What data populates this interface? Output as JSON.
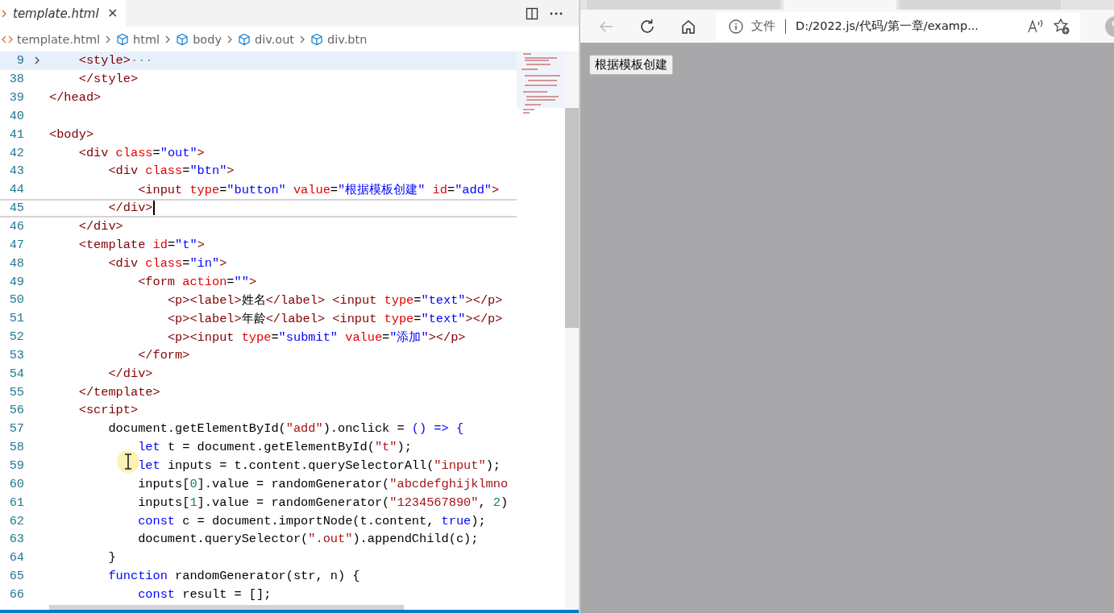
{
  "editor": {
    "tab": {
      "title": "template.html",
      "close": "✕"
    },
    "breadcrumbs": [
      {
        "kind": "file",
        "label": "template.html"
      },
      {
        "kind": "element",
        "label": "html"
      },
      {
        "kind": "element",
        "label": "body"
      },
      {
        "kind": "element",
        "label": "div.out"
      },
      {
        "kind": "element",
        "label": "div.btn"
      }
    ],
    "lines": [
      {
        "number": "9",
        "folded": true,
        "highlighted": true,
        "current": false,
        "tokens": [
          {
            "kind": "tag",
            "text": "    <style>"
          },
          {
            "kind": "fold",
            "text": "···"
          }
        ]
      },
      {
        "number": "38",
        "folded": false,
        "highlighted": false,
        "current": false,
        "tokens": [
          {
            "kind": "tag",
            "text": "    </style>"
          }
        ]
      },
      {
        "number": "39",
        "folded": false,
        "highlighted": false,
        "current": false,
        "tokens": [
          {
            "kind": "tag",
            "text": "</head>"
          }
        ]
      },
      {
        "number": "40",
        "folded": false,
        "highlighted": false,
        "current": false
      },
      {
        "number": "41",
        "folded": false,
        "highlighted": false,
        "current": false,
        "tokens": [
          {
            "kind": "tag",
            "text": "<body>"
          }
        ]
      },
      {
        "number": "42",
        "folded": false,
        "highlighted": false,
        "current": false,
        "tokens": [
          {
            "kind": "tag",
            "text": "    <div"
          },
          {
            "kind": "attr",
            "text": " class"
          },
          {
            "kind": "plain",
            "text": "="
          },
          {
            "kind": "val",
            "text": "\"out\""
          },
          {
            "kind": "tag",
            "text": ">"
          }
        ]
      },
      {
        "number": "43",
        "folded": false,
        "highlighted": false,
        "current": false,
        "tokens": [
          {
            "kind": "tag",
            "text": "        <div"
          },
          {
            "kind": "attr",
            "text": " class"
          },
          {
            "kind": "plain",
            "text": "="
          },
          {
            "kind": "val",
            "text": "\"btn\""
          },
          {
            "kind": "tag",
            "text": ">"
          }
        ]
      },
      {
        "number": "44",
        "folded": false,
        "highlighted": false,
        "current": false,
        "tokens": [
          {
            "kind": "tag",
            "text": "            <input"
          },
          {
            "kind": "attr",
            "text": " type"
          },
          {
            "kind": "plain",
            "text": "="
          },
          {
            "kind": "val",
            "text": "\"button\""
          },
          {
            "kind": "attr",
            "text": " value"
          },
          {
            "kind": "plain",
            "text": "="
          },
          {
            "kind": "val",
            "text": "\"根据模板创建\""
          },
          {
            "kind": "attr",
            "text": " id"
          },
          {
            "kind": "plain",
            "text": "="
          },
          {
            "kind": "val",
            "text": "\"add\""
          },
          {
            "kind": "tag",
            "text": ">"
          }
        ]
      },
      {
        "number": "45",
        "folded": false,
        "highlighted": false,
        "current": true,
        "tokens": [
          {
            "kind": "tag",
            "text": "        </div>"
          }
        ]
      },
      {
        "number": "46",
        "folded": false,
        "highlighted": false,
        "current": false,
        "tokens": [
          {
            "kind": "tag",
            "text": "    </div>"
          }
        ]
      },
      {
        "number": "47",
        "folded": false,
        "highlighted": false,
        "current": false,
        "tokens": [
          {
            "kind": "tag",
            "text": "    <template"
          },
          {
            "kind": "attr",
            "text": " id"
          },
          {
            "kind": "plain",
            "text": "="
          },
          {
            "kind": "val",
            "text": "\"t\""
          },
          {
            "kind": "tag",
            "text": ">"
          }
        ]
      },
      {
        "number": "48",
        "folded": false,
        "highlighted": false,
        "current": false,
        "tokens": [
          {
            "kind": "tag",
            "text": "        <div"
          },
          {
            "kind": "attr",
            "text": " class"
          },
          {
            "kind": "plain",
            "text": "="
          },
          {
            "kind": "val",
            "text": "\"in\""
          },
          {
            "kind": "tag",
            "text": ">"
          }
        ]
      },
      {
        "number": "49",
        "folded": false,
        "highlighted": false,
        "current": false,
        "tokens": [
          {
            "kind": "tag",
            "text": "            <form"
          },
          {
            "kind": "attr",
            "text": " action"
          },
          {
            "kind": "plain",
            "text": "="
          },
          {
            "kind": "val",
            "text": "\"\""
          },
          {
            "kind": "tag",
            "text": ">"
          }
        ]
      },
      {
        "number": "50",
        "folded": false,
        "highlighted": false,
        "current": false,
        "tokens": [
          {
            "kind": "tag",
            "text": "                <p><label>"
          },
          {
            "kind": "plain",
            "text": "姓名"
          },
          {
            "kind": "tag",
            "text": "</label>"
          },
          {
            "kind": "tag",
            "text": " <input"
          },
          {
            "kind": "attr",
            "text": " type"
          },
          {
            "kind": "plain",
            "text": "="
          },
          {
            "kind": "val",
            "text": "\"text\""
          },
          {
            "kind": "tag",
            "text": "></p>"
          }
        ]
      },
      {
        "number": "51",
        "folded": false,
        "highlighted": false,
        "current": false,
        "tokens": [
          {
            "kind": "tag",
            "text": "                <p><label>"
          },
          {
            "kind": "plain",
            "text": "年龄"
          },
          {
            "kind": "tag",
            "text": "</label>"
          },
          {
            "kind": "tag",
            "text": " <input"
          },
          {
            "kind": "attr",
            "text": " type"
          },
          {
            "kind": "plain",
            "text": "="
          },
          {
            "kind": "val",
            "text": "\"text\""
          },
          {
            "kind": "tag",
            "text": "></p>"
          }
        ]
      },
      {
        "number": "52",
        "folded": false,
        "highlighted": false,
        "current": false,
        "tokens": [
          {
            "kind": "tag",
            "text": "                <p><input"
          },
          {
            "kind": "attr",
            "text": " type"
          },
          {
            "kind": "plain",
            "text": "="
          },
          {
            "kind": "val",
            "text": "\"submit\""
          },
          {
            "kind": "attr",
            "text": " value"
          },
          {
            "kind": "plain",
            "text": "="
          },
          {
            "kind": "val",
            "text": "\"添加\""
          },
          {
            "kind": "tag",
            "text": "></p>"
          }
        ]
      },
      {
        "number": "53",
        "folded": false,
        "highlighted": false,
        "current": false,
        "tokens": [
          {
            "kind": "tag",
            "text": "            </form>"
          }
        ]
      },
      {
        "number": "54",
        "folded": false,
        "highlighted": false,
        "current": false,
        "tokens": [
          {
            "kind": "tag",
            "text": "        </div>"
          }
        ]
      },
      {
        "number": "55",
        "folded": false,
        "highlighted": false,
        "current": false,
        "tokens": [
          {
            "kind": "tag",
            "text": "    </template>"
          }
        ]
      },
      {
        "number": "56",
        "folded": false,
        "highlighted": false,
        "current": false,
        "tokens": [
          {
            "kind": "tag",
            "text": "    <script>"
          }
        ]
      },
      {
        "number": "57",
        "folded": false,
        "highlighted": false,
        "current": false,
        "tokens": [
          {
            "kind": "plain",
            "text": "        document.getElementById("
          },
          {
            "kind": "str",
            "text": "\"add\""
          },
          {
            "kind": "plain",
            "text": ").onclick = "
          },
          {
            "kind": "kw",
            "text": "() => {"
          }
        ]
      },
      {
        "number": "58",
        "folded": false,
        "highlighted": false,
        "current": false,
        "tokens": [
          {
            "kind": "kw",
            "text": "            let"
          },
          {
            "kind": "plain",
            "text": " t = document.getElementById("
          },
          {
            "kind": "str",
            "text": "\"t\""
          },
          {
            "kind": "plain",
            "text": ");"
          }
        ]
      },
      {
        "number": "59",
        "folded": false,
        "highlighted": false,
        "current": false,
        "tokens": [
          {
            "kind": "kw",
            "text": "            let"
          },
          {
            "kind": "plain",
            "text": " inputs = t.content.querySelectorAll("
          },
          {
            "kind": "str",
            "text": "\"input\""
          },
          {
            "kind": "plain",
            "text": ");"
          }
        ]
      },
      {
        "number": "60",
        "folded": false,
        "highlighted": false,
        "current": false,
        "tokens": [
          {
            "kind": "plain",
            "text": "            inputs["
          },
          {
            "kind": "num",
            "text": "0"
          },
          {
            "kind": "plain",
            "text": "].value = randomGenerator("
          },
          {
            "kind": "str",
            "text": "\"abcdefghijklmno"
          }
        ]
      },
      {
        "number": "61",
        "folded": false,
        "highlighted": false,
        "current": false,
        "tokens": [
          {
            "kind": "plain",
            "text": "            inputs["
          },
          {
            "kind": "num",
            "text": "1"
          },
          {
            "kind": "plain",
            "text": "].value = randomGenerator("
          },
          {
            "kind": "str",
            "text": "\"1234567890\""
          },
          {
            "kind": "plain",
            "text": ", "
          },
          {
            "kind": "num",
            "text": "2"
          },
          {
            "kind": "plain",
            "text": ")"
          }
        ]
      },
      {
        "number": "62",
        "folded": false,
        "highlighted": false,
        "current": false,
        "tokens": [
          {
            "kind": "kw",
            "text": "            const"
          },
          {
            "kind": "plain",
            "text": " c = document.importNode(t.content, "
          },
          {
            "kind": "kw",
            "text": "true"
          },
          {
            "kind": "plain",
            "text": ");"
          }
        ]
      },
      {
        "number": "63",
        "folded": false,
        "highlighted": false,
        "current": false,
        "tokens": [
          {
            "kind": "plain",
            "text": "            document.querySelector("
          },
          {
            "kind": "str",
            "text": "\".out\""
          },
          {
            "kind": "plain",
            "text": ").appendChild(c);"
          }
        ]
      },
      {
        "number": "64",
        "folded": false,
        "highlighted": false,
        "current": false,
        "tokens": [
          {
            "kind": "plain",
            "text": "        }"
          }
        ]
      },
      {
        "number": "65",
        "folded": false,
        "highlighted": false,
        "current": false,
        "tokens": [
          {
            "kind": "kw",
            "text": "        function"
          },
          {
            "kind": "plain",
            "text": " randomGenerator(str, n) {"
          }
        ]
      },
      {
        "number": "66",
        "folded": false,
        "highlighted": false,
        "current": false,
        "tokens": [
          {
            "kind": "kw",
            "text": "            const"
          },
          {
            "kind": "plain",
            "text": " result = [];"
          }
        ]
      }
    ]
  },
  "browser": {
    "tabs": [
      {
        "selected": false
      },
      {
        "selected": true
      },
      {
        "selected": false
      }
    ],
    "address": {
      "info": "文件",
      "url": "D:/2022.js/代码/第一章/examp..."
    },
    "page_button": "根据模板创建"
  }
}
